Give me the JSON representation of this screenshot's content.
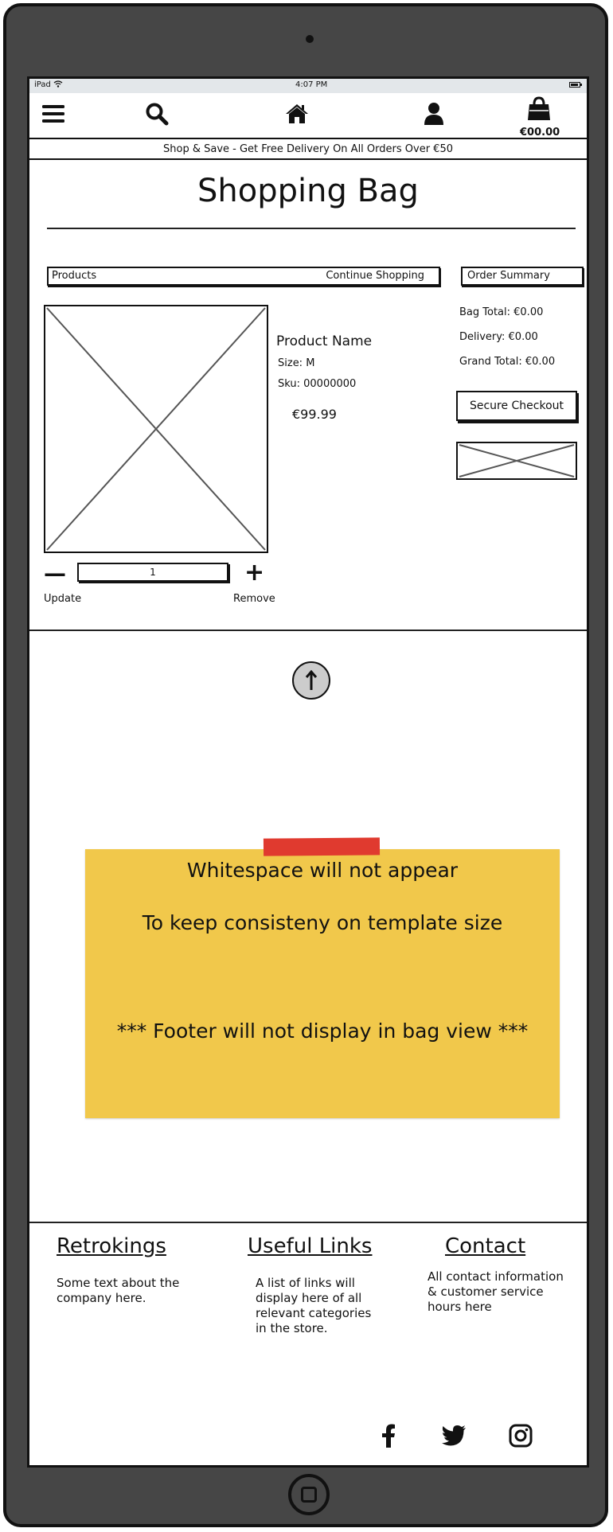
{
  "status_bar": {
    "device": "iPad",
    "time": "4:07 PM"
  },
  "header": {
    "bag_total": "€00.00",
    "icons": [
      "menu-icon",
      "search-icon",
      "home-icon",
      "user-icon",
      "shopping-bag-icon"
    ]
  },
  "banner": {
    "text": "Shop & Save - Get Free Delivery On All Orders Over €50"
  },
  "page": {
    "title": "Shopping Bag"
  },
  "products_bar": {
    "label": "Products",
    "continue_link": "Continue Shopping"
  },
  "product": {
    "name": "Product Name",
    "size": "Size: M",
    "sku": "Sku: 00000000",
    "price": "€99.99",
    "quantity": "1",
    "update_label": "Update",
    "remove_label": "Remove"
  },
  "summary": {
    "header": "Order Summary",
    "bag_total": "Bag Total: €0.00",
    "delivery": "Delivery: €0.00",
    "grand_total": "Grand Total: €0.00",
    "checkout_label": "Secure Checkout"
  },
  "note": {
    "line1": "Whitespace will not appear",
    "line2": "To keep consisteny on template size",
    "line3": "*** Footer will not display in bag view ***"
  },
  "footer": {
    "columns": [
      {
        "heading": "Retrokings",
        "text": "Some text about the company here."
      },
      {
        "heading": "Useful Links",
        "text": "A list of links will display here of all relevant categories in the store."
      },
      {
        "heading": "Contact",
        "text": "All contact information & customer service hours here"
      }
    ],
    "social_icons": [
      "facebook-icon",
      "twitter-icon",
      "instagram-icon"
    ]
  }
}
